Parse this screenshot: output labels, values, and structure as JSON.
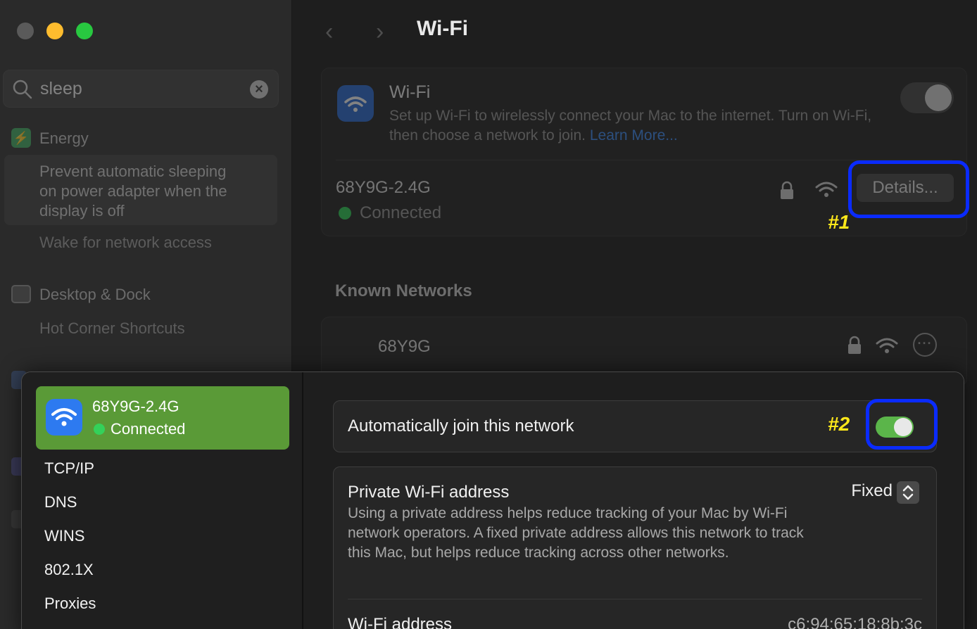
{
  "sidebar": {
    "search": {
      "value": "sleep"
    },
    "energy": {
      "heading": "Energy",
      "selected_result": "Prevent automatic sleeping on power adapter when the display is off",
      "result_2": "Wake for network access"
    },
    "dock": {
      "heading": "Desktop & Dock",
      "result_1": "Hot Corner Shortcuts"
    }
  },
  "main": {
    "title": "Wi-Fi",
    "wifi_card": {
      "heading": "Wi-Fi",
      "description": "Set up Wi-Fi to wirelessly connect your Mac to the internet. Turn on Wi-Fi, then choose a network to join.",
      "learn_more": "Learn More...",
      "current_network": "68Y9G-2.4G",
      "status": "Connected",
      "details_label": "Details..."
    },
    "known_networks": {
      "title": "Known Networks",
      "items": [
        {
          "name": "68Y9G"
        }
      ]
    }
  },
  "annotations": {
    "label_1": "#1",
    "label_2": "#2"
  },
  "sheet": {
    "network": {
      "name": "68Y9G-2.4G",
      "status": "Connected"
    },
    "nav_items": [
      "TCP/IP",
      "DNS",
      "WINS",
      "802.1X",
      "Proxies"
    ],
    "auto_join": {
      "label": "Automatically join this network",
      "enabled": true
    },
    "private_address": {
      "label": "Private Wi-Fi address",
      "value": "Fixed",
      "description": "Using a private address helps reduce tracking of your Mac by Wi-Fi network operators. A fixed private address allows this network to track this Mac, but helps reduce tracking across other networks."
    },
    "wifi_address": {
      "label": "Wi-Fi address",
      "value": "c6:94:65:18:8b:3c"
    }
  },
  "colors": {
    "accent_blue": "#3f8ef7",
    "toggle_green": "#5bb54a",
    "selected_green": "#5a9a37",
    "annotation_blue": "#0a2bff",
    "annotation_yellow": "#ffe81a"
  }
}
